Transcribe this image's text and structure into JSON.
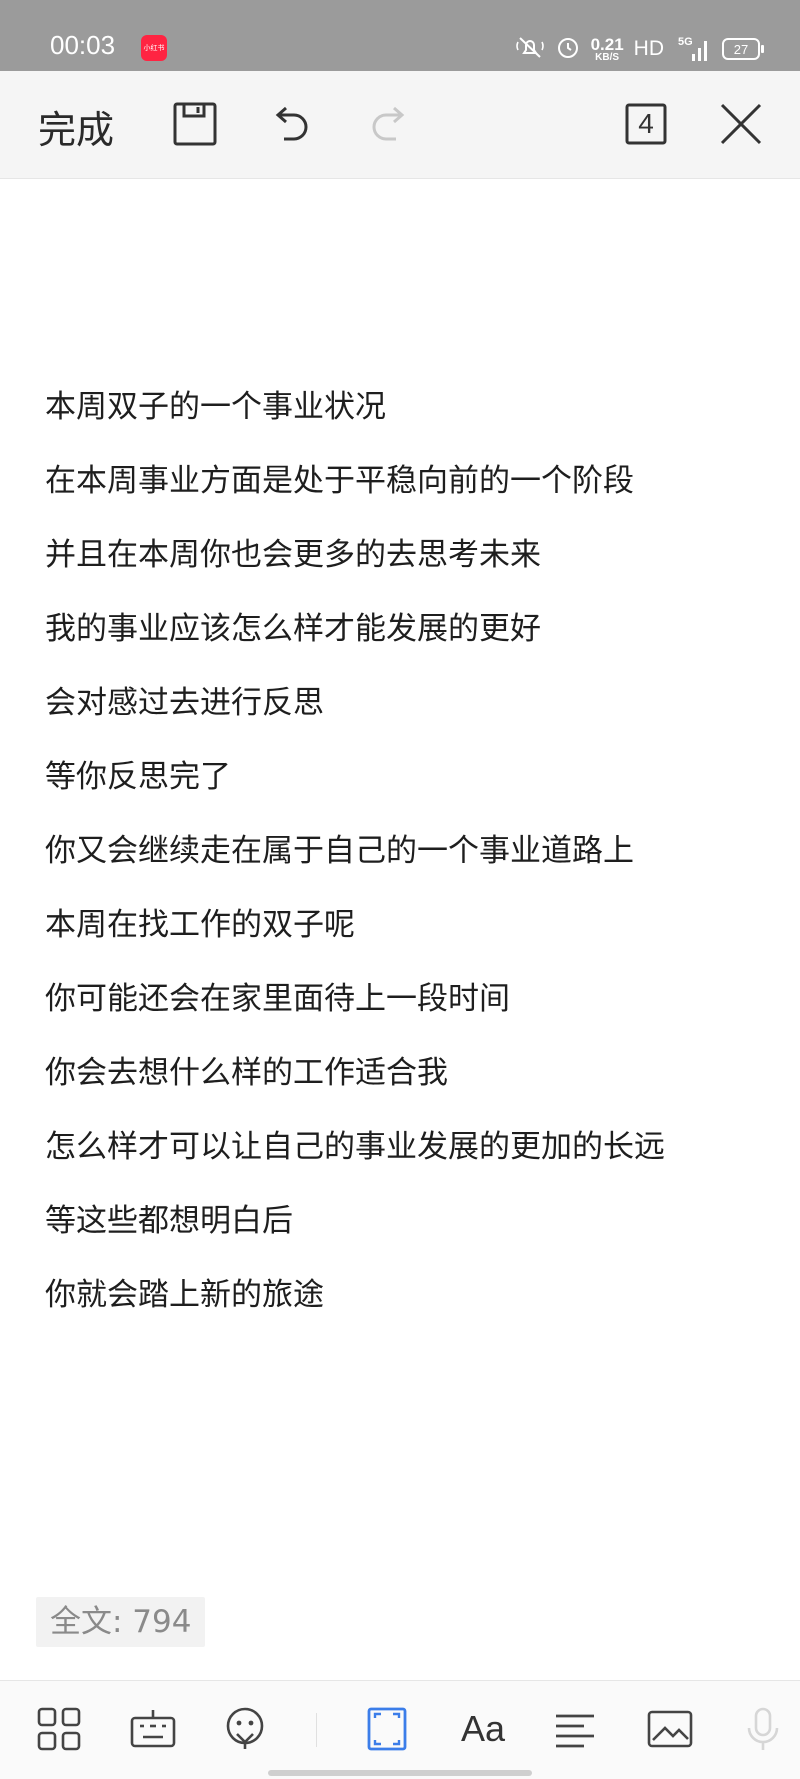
{
  "status_bar": {
    "time": "00:03",
    "app_badge": "小红书",
    "net_speed_value": "0.21",
    "net_speed_unit": "KB/S",
    "hd": "HD",
    "network": "5G",
    "battery": "27"
  },
  "toolbar": {
    "done_label": "完成",
    "page_count": "4"
  },
  "document": {
    "lines": [
      "本周双子的一个事业状况",
      "在本周事业方面是处于平稳向前的一个阶段",
      "并且在本周你也会更多的去思考未来",
      "我的事业应该怎么样才能发展的更好",
      "会对感过去进行反思",
      "等你反思完了",
      "你又会继续走在属于自己的一个事业道路上",
      "本周在找工作的双子呢",
      "你可能还会在家里面待上一段时间",
      "你会去想什么样的工作适合我",
      "怎么样才可以让自己的事业发展的更加的长远",
      "等这些都想明白后",
      "你就会踏上新的旅途"
    ]
  },
  "word_count": "全文: 794",
  "bottom_toolbar": {
    "font_label": "Aa"
  },
  "colors": {
    "status_bar_bg": "#9b9b9b",
    "toolbar_bg": "#f5f5f5",
    "accent_blue": "#3b7de9",
    "app_badge_red": "#ff2442"
  }
}
